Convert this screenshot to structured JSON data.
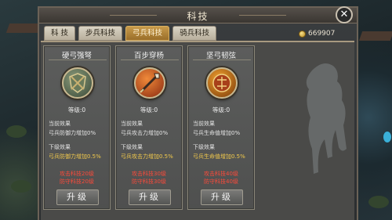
{
  "window": {
    "title": "科技"
  },
  "tabs": [
    {
      "label": "科 技",
      "active": false
    },
    {
      "label": "步兵科技",
      "active": false
    },
    {
      "label": "弓兵科技",
      "active": true
    },
    {
      "label": "骑兵科技",
      "active": false
    }
  ],
  "currency": {
    "icon": "coin-icon",
    "amount": "669907"
  },
  "cards": [
    {
      "name": "硬弓强弩",
      "icon": "shield-emblem-icon",
      "level": "等级:0",
      "current_label": "当前效果",
      "current_value": "弓兵防御力增加0%",
      "next_label": "下级效果",
      "next_value": "弓兵防御力增加0.5%",
      "req1": "攻击科技20级",
      "req2": "防守科技20级",
      "button": "升级"
    },
    {
      "name": "百步穿杨",
      "icon": "spear-emblem-icon",
      "level": "等级:0",
      "current_label": "当前效果",
      "current_value": "弓兵攻击力增加0%",
      "next_label": "下级效果",
      "next_value": "弓兵攻击力增加0.5%",
      "req1": "攻击科技30级",
      "req2": "防守科技30级",
      "button": "升级"
    },
    {
      "name": "坚弓韧弦",
      "icon": "crest-emblem-icon",
      "level": "等级:0",
      "current_label": "当前效果",
      "current_value": "弓兵生命值增加0%",
      "next_label": "下级效果",
      "next_value": "弓兵生命值增加0.5%",
      "req1": "攻击科技40级",
      "req2": "防守科技40级",
      "button": "升级"
    }
  ],
  "colors": {
    "next_effect": "#f2c94c",
    "requirement": "#ff4a3a",
    "active_tab": "#c79a4a"
  }
}
